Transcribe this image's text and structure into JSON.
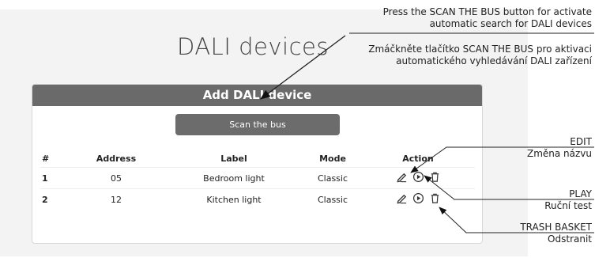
{
  "page": {
    "title": "DALI devices"
  },
  "card": {
    "header": "Add DALI device",
    "scan_label": "Scan the bus"
  },
  "table": {
    "headers": {
      "num": "#",
      "address": "Address",
      "label": "Label",
      "mode": "Mode",
      "action": "Action"
    },
    "rows": [
      {
        "num": "1",
        "address": "05",
        "label": "Bedroom light",
        "mode": "Classic"
      },
      {
        "num": "2",
        "address": "12",
        "label": "Kitchen light",
        "mode": "Classic"
      }
    ]
  },
  "annotations": {
    "scan_en_1": "Press the SCAN THE BUS button for activate",
    "scan_en_2": "automatic search for DALI devices",
    "scan_cz_1": "Zmáčkněte tlačítko SCAN THE BUS pro aktivaci",
    "scan_cz_2": "automatického vyhledávání DALI zařízení",
    "edit_en": "EDIT",
    "edit_cz": "Změna názvu",
    "play_en": "PLAY",
    "play_cz": "Ruční test",
    "trash_en": "TRASH BASKET",
    "trash_cz": "Odstranit"
  },
  "icons": {
    "edit": "pencil-icon",
    "play": "play-icon",
    "trash": "trash-icon"
  },
  "colors": {
    "header_bg": "#6a6a6a",
    "button_bg": "#6c6c6c",
    "screen_bg": "#f3f3f3"
  }
}
